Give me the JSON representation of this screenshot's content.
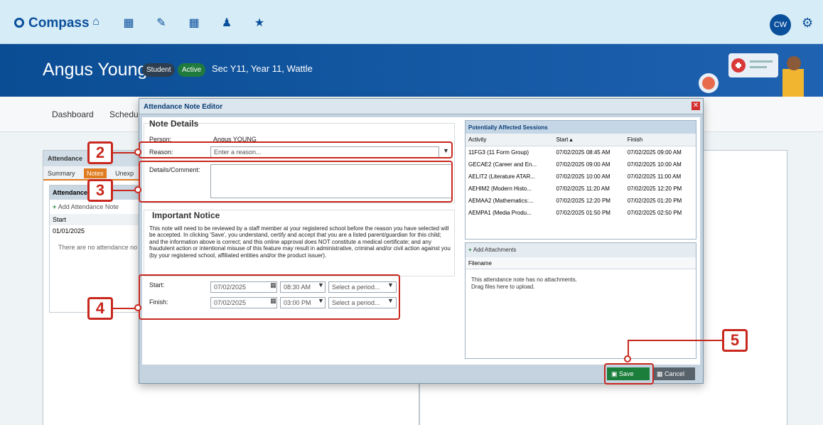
{
  "topbar": {
    "logo": "Compass",
    "avatar": "CW",
    "nav_icons": [
      "home-icon",
      "calendar-icon",
      "pencil-icon",
      "grid-icon",
      "people-icon",
      "star-icon"
    ]
  },
  "header": {
    "student_name": "Angus Young",
    "badge_student": "Student",
    "badge_active": "Active",
    "year_info": "Sec Y11, Year 11, Wattle"
  },
  "page": {
    "nav": [
      "Dashboard",
      "Schedul"
    ],
    "panel_title": "Attendance",
    "tabs": [
      "Summary",
      "Notes",
      "Unexp"
    ],
    "subpanel_title": "Attendance",
    "add_note": "Add Attendance Note",
    "start_col": "Start",
    "start_date": "01/01/2025",
    "empty": "There are no attendance no"
  },
  "modal": {
    "title": "Attendance Note Editor",
    "note_details": "Note Details",
    "person_label": "Person:",
    "person_value": "Angus YOUNG",
    "reason_label": "Reason:",
    "reason_placeholder": "Enter a reason...",
    "details_label": "Details/Comment:",
    "important_notice": "Important Notice",
    "notice_text": "This note will need to be reviewed by a staff member at your registered school before the reason you have selected will be accepted. In clicking 'Save', you understand, certify and accept that you are a listed parent/guardian for this child; and the information above is correct; and this online approval does NOT constitute a medical certificate; and any fraudulent action or intentional misuse of this feature may result in administrative, criminal and/or civil action against you (by your registered school, affiliated entities and/or the product issuer).",
    "start_label": "Start:",
    "start_date": "07/02/2025",
    "start_time": "08:30 AM",
    "start_period": "Select a period...",
    "finish_label": "Finish:",
    "finish_date": "07/02/2025",
    "finish_time": "03:00 PM",
    "finish_period": "Select a period...",
    "sessions_title": "Potentially Affected Sessions",
    "sessions_headers": [
      "Activity",
      "Start ▴",
      "Finish"
    ],
    "sessions": [
      [
        "11FG3 (11 Form Group)",
        "07/02/2025 08:45 AM",
        "07/02/2025 09:00 AM"
      ],
      [
        "GECAE2 (Career and En...",
        "07/02/2025 09:00 AM",
        "07/02/2025 10:00 AM"
      ],
      [
        "AELIT2 (Literature ATAR...",
        "07/02/2025 10:00 AM",
        "07/02/2025 11:00 AM"
      ],
      [
        "AEHIM2 (Modern Histo...",
        "07/02/2025 11:20 AM",
        "07/02/2025 12:20 PM"
      ],
      [
        "AEMAA2 (Mathematics:...",
        "07/02/2025 12:20 PM",
        "07/02/2025 01:20 PM"
      ],
      [
        "AEMPA1 (Media Produ...",
        "07/02/2025 01:50 PM",
        "07/02/2025 02:50 PM"
      ]
    ],
    "add_attachments": "Add Attachments",
    "filename_col": "Filename",
    "no_attachments": "This attendance note has no attachments.",
    "drag_hint": "Drag files here to upload.",
    "save": "Save",
    "cancel": "Cancel"
  },
  "callouts": [
    "2",
    "3",
    "4",
    "5"
  ]
}
